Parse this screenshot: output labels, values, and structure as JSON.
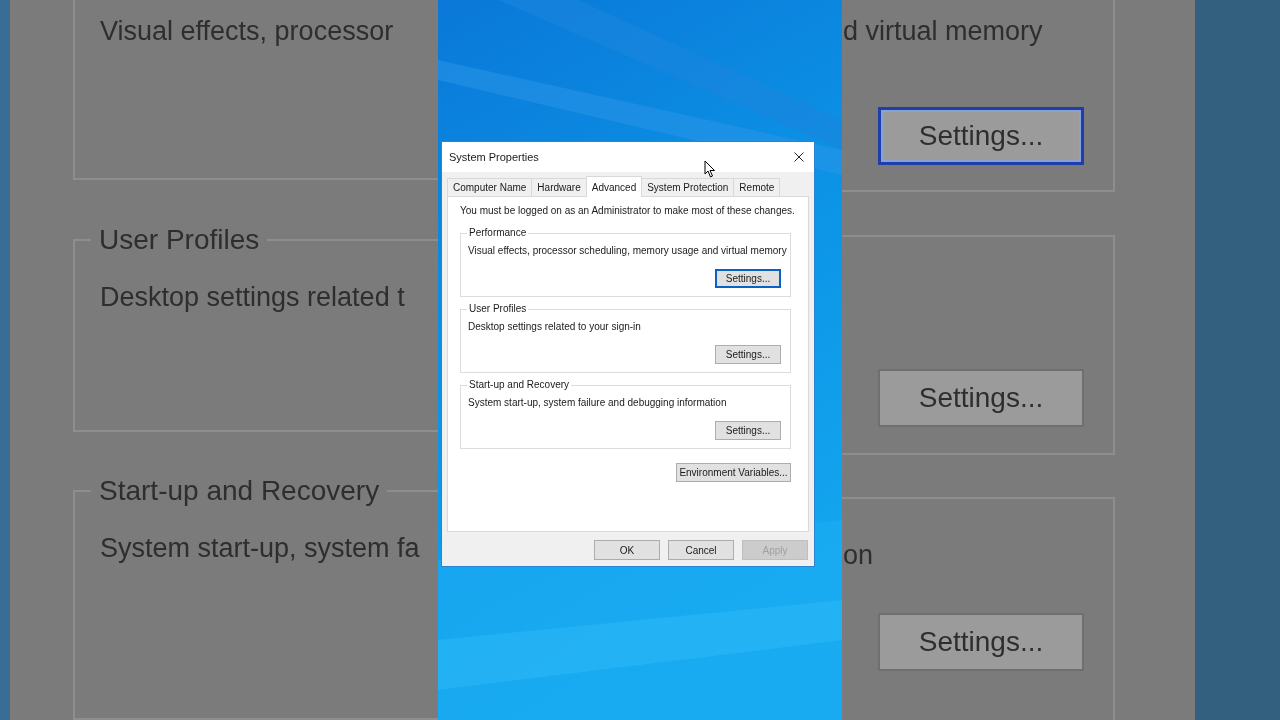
{
  "backdrop_left": [
    {
      "description": "Visual effects, processor"
    },
    {
      "legend": "User Profiles",
      "description": "Desktop settings related t"
    },
    {
      "legend": "Start-up and Recovery",
      "description": "System start-up, system fa"
    }
  ],
  "backdrop_right": [
    {
      "description": "d virtual memory",
      "button": "Settings...",
      "focused": true
    },
    {
      "button": "Settings...",
      "focused": false
    },
    {
      "description": "on",
      "button": "Settings...",
      "focused": false
    }
  ],
  "dialog": {
    "title": "System Properties",
    "tabs": [
      {
        "label": "Computer Name",
        "selected": false
      },
      {
        "label": "Hardware",
        "selected": false
      },
      {
        "label": "Advanced",
        "selected": true
      },
      {
        "label": "System Protection",
        "selected": false
      },
      {
        "label": "Remote",
        "selected": false
      }
    ],
    "notice": "You must be logged on as an Administrator to make most of these changes.",
    "groups": [
      {
        "legend": "Performance",
        "description": "Visual effects, processor scheduling, memory usage and virtual memory",
        "button": "Settings...",
        "focused": true
      },
      {
        "legend": "User Profiles",
        "description": "Desktop settings related to your sign-in",
        "button": "Settings...",
        "focused": false
      },
      {
        "legend": "Start-up and Recovery",
        "description": "System start-up, system failure and debugging information",
        "button": "Settings...",
        "focused": false
      }
    ],
    "env_button": "Environment Variables...",
    "buttons": [
      {
        "label": "OK",
        "disabled": false
      },
      {
        "label": "Cancel",
        "disabled": false
      },
      {
        "label": "Apply",
        "disabled": true
      }
    ]
  }
}
